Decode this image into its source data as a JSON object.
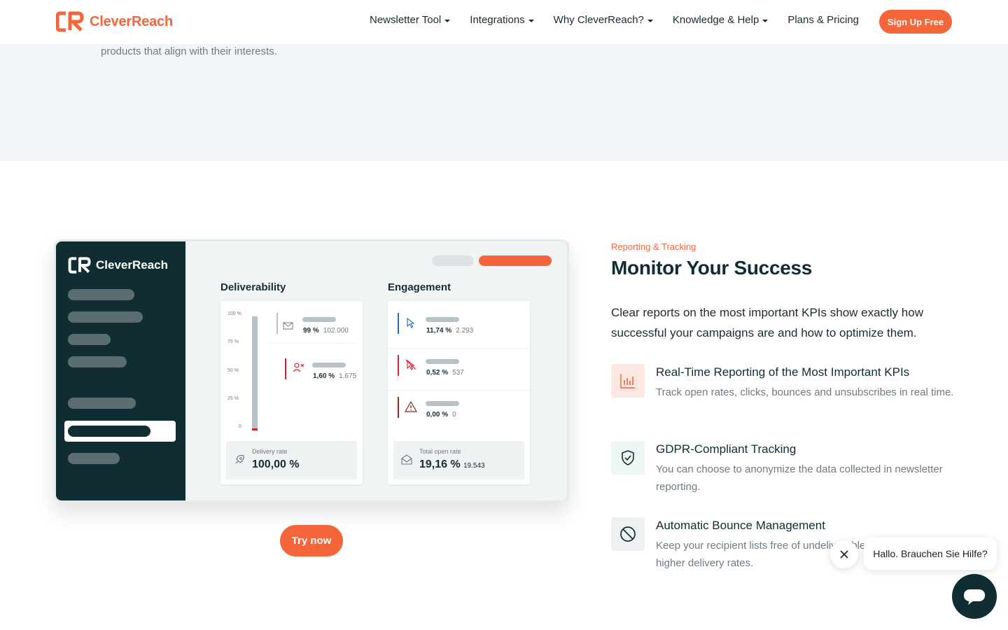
{
  "header": {
    "brand": "CleverReach",
    "nav": [
      {
        "label": "Newsletter Tool",
        "has_menu": true
      },
      {
        "label": "Integrations",
        "has_menu": true
      },
      {
        "label": "Why CleverReach?",
        "has_menu": true
      },
      {
        "label": "Knowledge & Help",
        "has_menu": true
      },
      {
        "label": "Plans & Pricing",
        "has_menu": false
      }
    ],
    "signup_label": "Sign Up Free"
  },
  "band": {
    "text": "products that align with their interests."
  },
  "dashboard": {
    "brand": "CleverReach",
    "deliverability": {
      "title": "Deliverability",
      "y_ticks": [
        "100 %",
        "75 %",
        "50 %",
        "25 %",
        "0"
      ],
      "delivered": {
        "pct": "99 %",
        "count": "102.000"
      },
      "bounced": {
        "pct": "1,60 %",
        "count": "1.675"
      },
      "summary_label": "Delivery rate",
      "summary_value": "100,00 %"
    },
    "engagement": {
      "title": "Engagement",
      "clicks": {
        "pct": "11,74 %",
        "count": "2.293"
      },
      "unsubscribes": {
        "pct": "0,52 %",
        "count": "537"
      },
      "complaints": {
        "pct": "0,00 %",
        "count": "0"
      },
      "summary_label": "Total open rate",
      "summary_value": "19,16 %",
      "summary_count": "19.543"
    }
  },
  "try_label": "Try now",
  "section": {
    "eyebrow": "Reporting & Tracking",
    "title": "Monitor Your Success",
    "lead": "Clear reports on the most important KPIs show exactly how successful your campaigns are and how to optimize them.",
    "features": [
      {
        "icon": "bar-chart-icon",
        "title": "Real-Time Reporting of the Most Important KPIs",
        "text": "Track open rates, clicks, bounces and unsubscribes in real time."
      },
      {
        "icon": "shield-check-icon",
        "title": "GDPR-Compliant Tracking",
        "text": "You can choose to anonymize the data collected in newsletter reporting."
      },
      {
        "icon": "block-icon",
        "title": "Automatic Bounce Management",
        "text": "Keep your recipient lists free of undeliverable addresses for higher delivery rates."
      }
    ]
  },
  "chat": {
    "message": "Hallo. Brauchen Sie Hilfe?"
  },
  "colors": {
    "accent": "#f4653a",
    "dark": "#0f2d33",
    "danger": "#d4242f",
    "info": "#1f6fb2"
  }
}
